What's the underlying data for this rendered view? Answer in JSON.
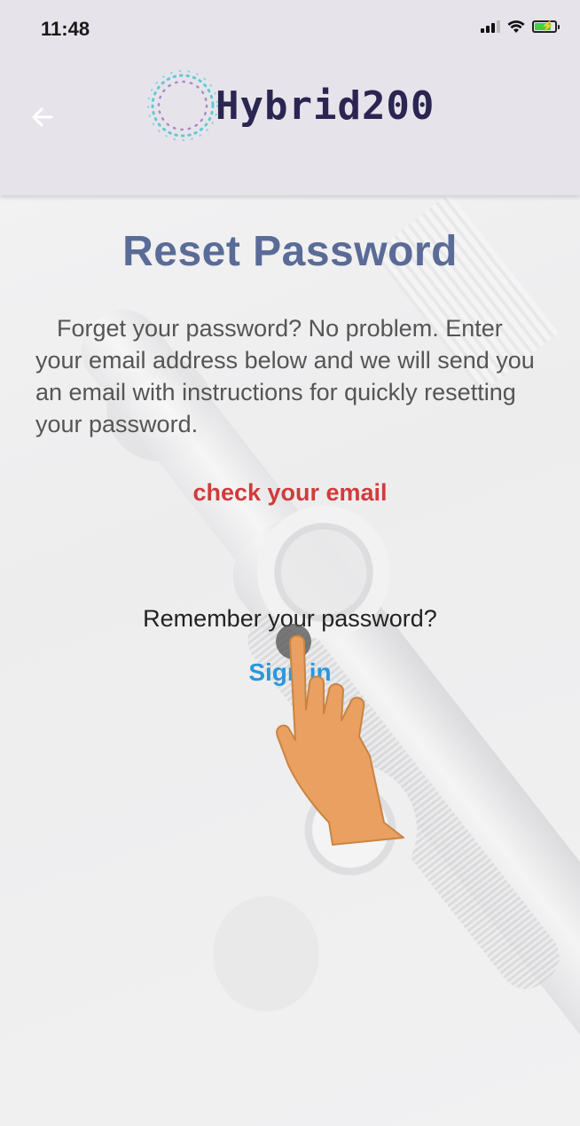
{
  "status_bar": {
    "time": "11:48"
  },
  "header": {
    "back_icon": "arrow-left-icon",
    "logo_text": "Hybrid200",
    "logo_icon": "dotted-ring-logo-icon"
  },
  "page": {
    "title": "Reset Password",
    "description": "Forget your password? No problem. Enter your email address below and we will send you an email with instructions for quickly resetting your password.",
    "status_message": "check your email",
    "remember_prompt": "Remember your password?",
    "sign_in_link": "Sign in"
  },
  "colors": {
    "header_bg": "#e6e4ea",
    "title": "#5a6b97",
    "status_message": "#d23b3b",
    "link": "#2b97dd",
    "logo_text": "#2b2552"
  },
  "overlay": {
    "tap_indicator_icon": "pointing-hand-icon"
  }
}
